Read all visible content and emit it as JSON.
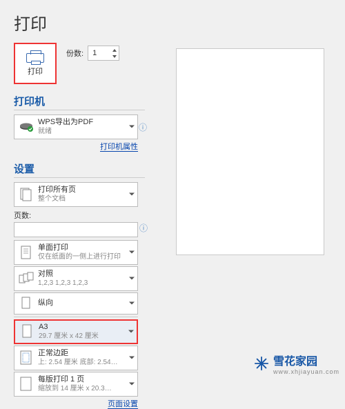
{
  "title": "打印",
  "print_button": {
    "label": "打印"
  },
  "copies": {
    "label": "份数:",
    "value": "1"
  },
  "sections": {
    "printer": "打印机",
    "settings": "设置"
  },
  "printer_dd": {
    "name": "WPS导出为PDF",
    "status": "就绪"
  },
  "link_printer_props": "打印机属性",
  "pages_label": "页数:",
  "scope_dd": {
    "title": "打印所有页",
    "sub": "整个文档"
  },
  "side_dd": {
    "title": "单面打印",
    "sub": "仅在纸面的一侧上进行打印"
  },
  "collate_dd": {
    "title": "对照",
    "sub": "1,2,3   1,2,3   1,2,3"
  },
  "orient_dd": {
    "title": "纵向"
  },
  "paper_dd": {
    "title": "A3",
    "sub": "29.7 厘米 x 42 厘米"
  },
  "margin_dd": {
    "title": "正常边距",
    "sub": "上: 2.54 厘米 底部: 2.54…"
  },
  "perpage_dd": {
    "title": "每版打印 1 页",
    "sub": "缩放到 14 厘米 x 20.3…"
  },
  "link_page_setup": "页面设置",
  "watermark": {
    "brand": "雪花家园",
    "url": "www.xhjiayuan.com"
  }
}
